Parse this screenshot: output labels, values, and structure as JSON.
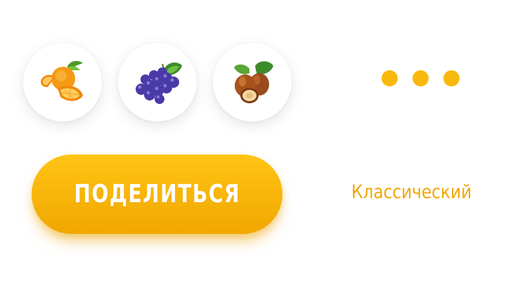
{
  "ingredients": [
    {
      "icon": "orange-icon"
    },
    {
      "icon": "grapes-icon"
    },
    {
      "icon": "hazelnut-icon"
    }
  ],
  "more_indicator": {
    "icon": "more-dots-icon"
  },
  "share_button": {
    "label": "ПОДЕЛИТЬСЯ"
  },
  "flavor": {
    "label": "Классический"
  },
  "colors": {
    "accent": "#f9b90c",
    "accent_dark": "#f0a700",
    "flavor_text": "#f0a708",
    "background": "#ffffff"
  }
}
